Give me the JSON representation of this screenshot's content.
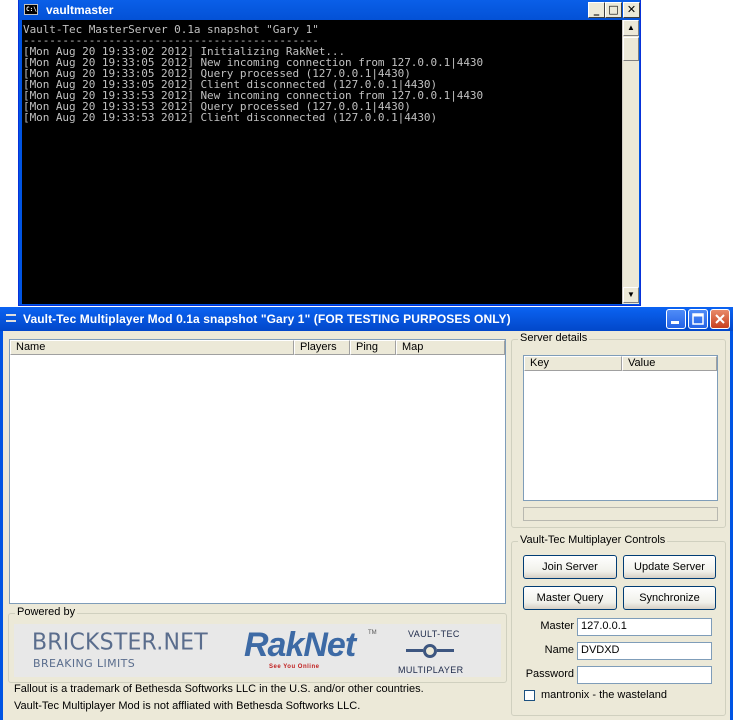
{
  "console": {
    "title": "vaultmaster",
    "icon_text": "C:\\",
    "lines": [
      "Vault-Tec MasterServer 0.1a snapshot \"Gary 1\"",
      "---------------------------------------------",
      "",
      "[Mon Aug 20 19:33:02 2012] Initializing RakNet...",
      "[Mon Aug 20 19:33:05 2012] New incoming connection from 127.0.0.1|4430",
      "[Mon Aug 20 19:33:05 2012] Query processed (127.0.0.1|4430)",
      "[Mon Aug 20 19:33:05 2012] Client disconnected (127.0.0.1|4430)",
      "[Mon Aug 20 19:33:53 2012] New incoming connection from 127.0.0.1|4430",
      "[Mon Aug 20 19:33:53 2012] Query processed (127.0.0.1|4430)",
      "[Mon Aug 20 19:33:53 2012] Client disconnected (127.0.0.1|4430)"
    ],
    "buttons": {
      "minimize": "_",
      "maximize": "□",
      "close": "✕"
    },
    "scroll": {
      "up": "▲",
      "down": "▼"
    }
  },
  "mp": {
    "title": "Vault-Tec Multiplayer Mod 0.1a snapshot \"Gary 1\" (FOR TESTING PURPOSES ONLY)",
    "server_list": {
      "columns": [
        "Name",
        "Players",
        "Ping",
        "Map"
      ]
    },
    "powered_by": {
      "label": "Powered by",
      "brickster": "BRICKSTER.NET",
      "brickster_sub": "BREAKING LIMITS",
      "raknet": "RakNet",
      "raknet_tm": "TM",
      "raknet_sub": "See You Online",
      "vaulttec_top": "VAULT-TEC",
      "vaulttec_bottom": "MULTIPLAYER"
    },
    "footer": [
      "Fallout is a trademark of Bethesda Softworks LLC in the U.S. and/or other countries.",
      "Vault-Tec Multiplayer Mod is not affliated with Bethesda Softworks LLC."
    ],
    "server_details": {
      "label": "Server details",
      "columns": [
        "Key",
        "Value"
      ]
    },
    "controls": {
      "label": "Vault-Tec Multiplayer Controls",
      "join": "Join Server",
      "update": "Update Server",
      "master_query": "Master Query",
      "synchronize": "Synchronize",
      "master_label": "Master",
      "master_value": "127.0.0.1",
      "name_label": "Name",
      "name_value": "DVDXD",
      "password_label": "Password",
      "password_value": "",
      "checkbox_label": "mantronix - the wasteland",
      "checkbox_checked": false
    }
  },
  "colors": {
    "titlebar": "#0054e3",
    "console_bg": "#000000",
    "console_text": "#c0c0c0",
    "dialog_bg": "#ece9d8"
  }
}
